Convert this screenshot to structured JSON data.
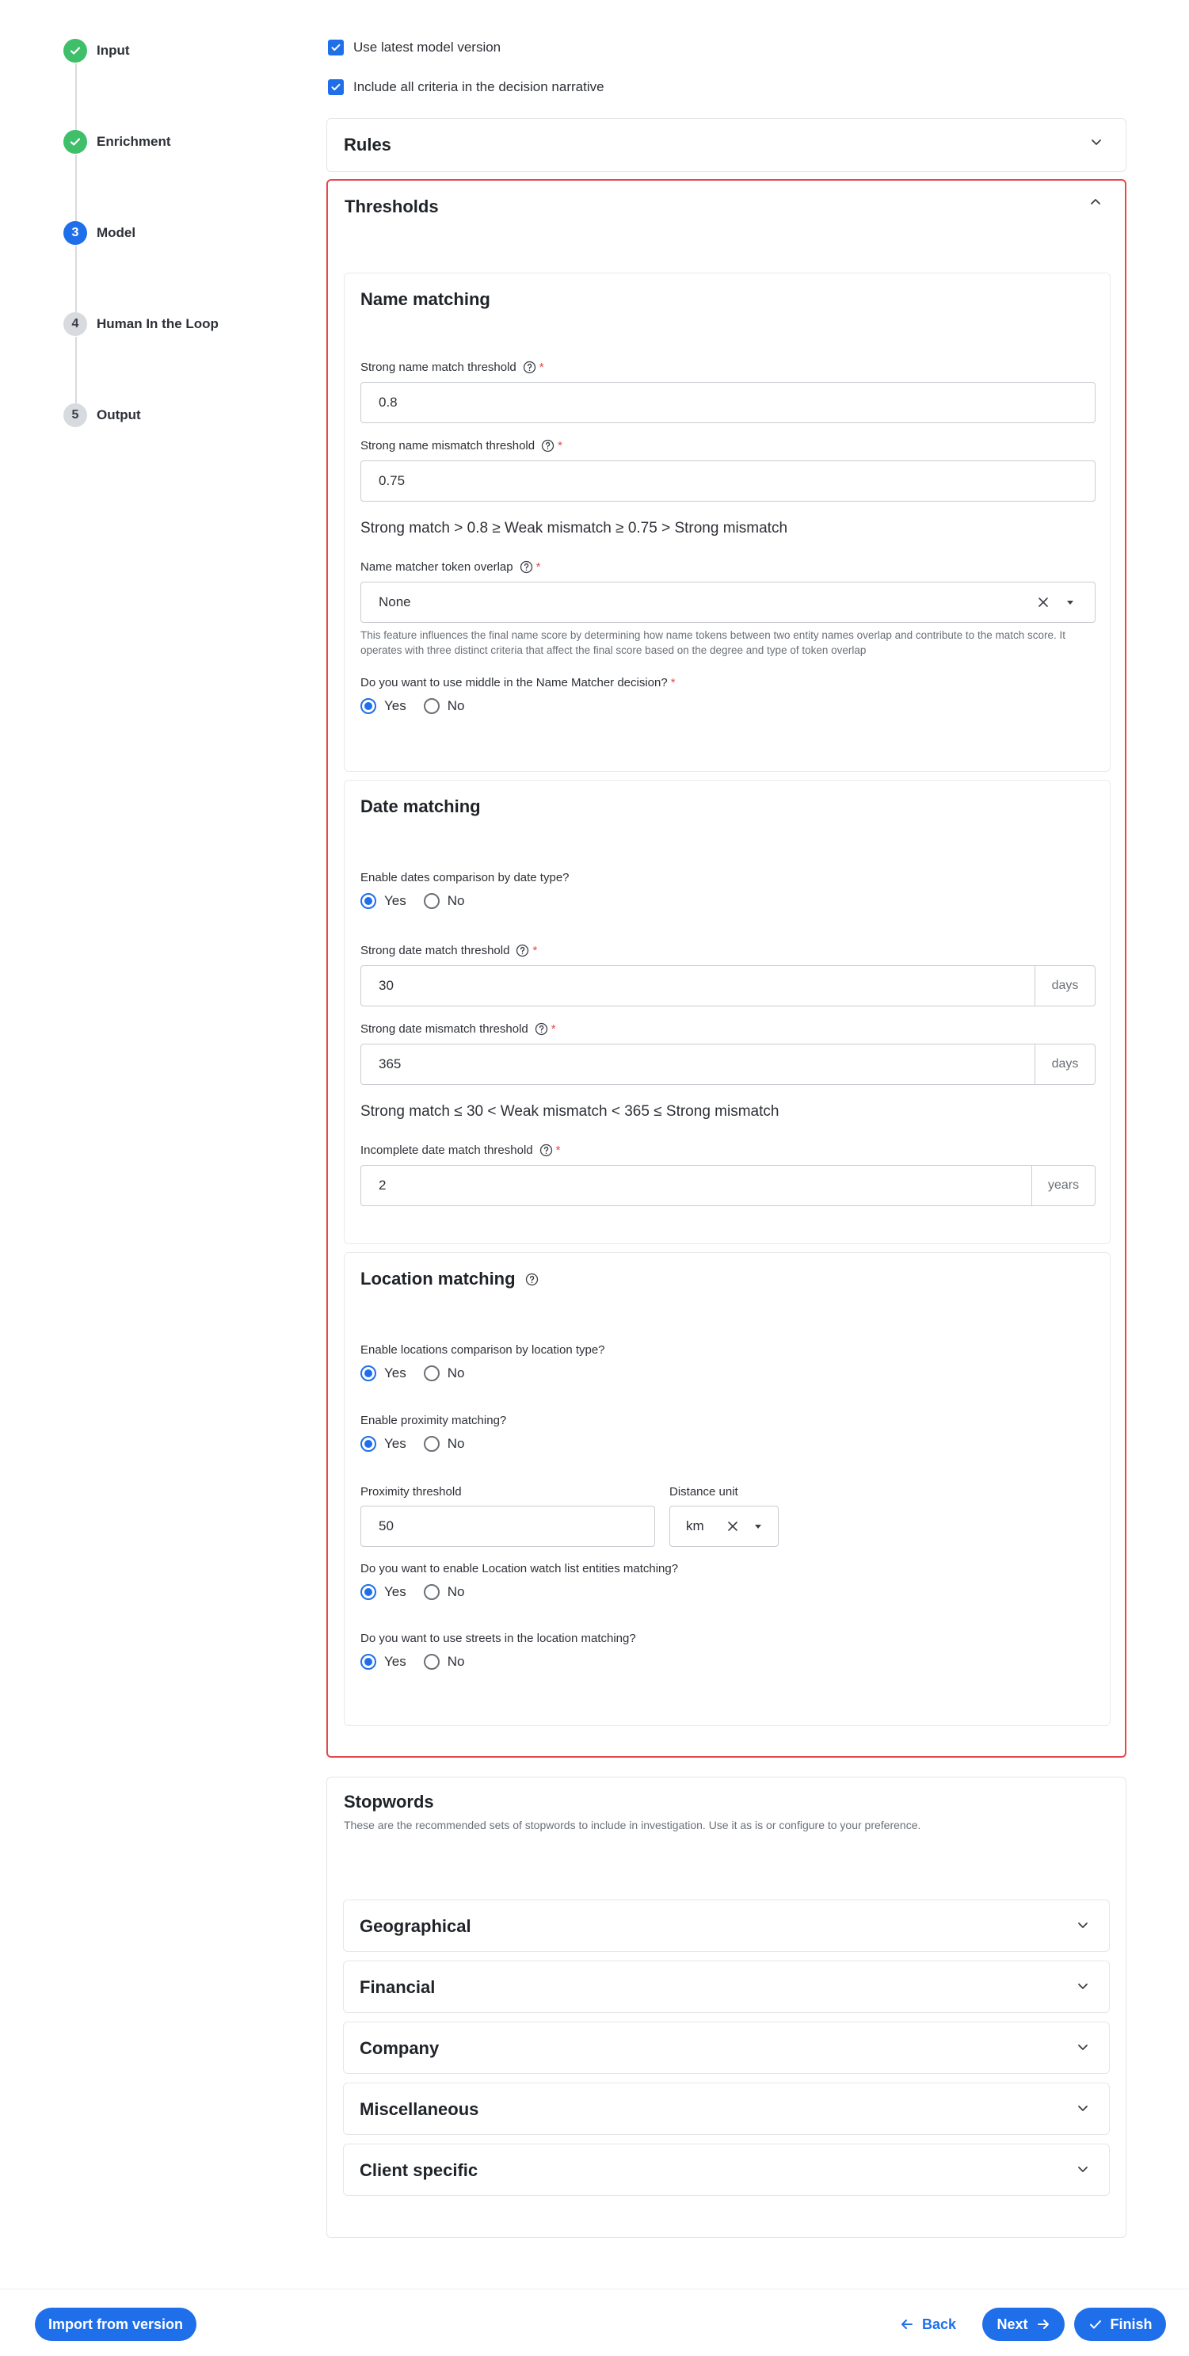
{
  "stepper": {
    "steps": [
      {
        "label": "Input",
        "state": "done",
        "number": ""
      },
      {
        "label": "Enrichment",
        "state": "done",
        "number": ""
      },
      {
        "label": "Model",
        "state": "active",
        "number": "3"
      },
      {
        "label": "Human In the Loop",
        "state": "todo",
        "number": "4"
      },
      {
        "label": "Output",
        "state": "todo",
        "number": "5"
      }
    ]
  },
  "options": {
    "use_latest_model": "Use latest model version",
    "include_all_criteria": "Include all criteria in the decision narrative"
  },
  "rules": {
    "title": "Rules"
  },
  "thresholds": {
    "title": "Thresholds",
    "name_matching": {
      "title": "Name matching",
      "strong_match_label": "Strong name match threshold",
      "strong_match_value": "0.8",
      "strong_mismatch_label": "Strong name mismatch threshold",
      "strong_mismatch_value": "0.75",
      "formula": "Strong match > 0.8 ≥ Weak mismatch ≥ 0.75 > Strong mismatch",
      "token_overlap_label": "Name matcher token overlap",
      "token_overlap_value": "None",
      "token_overlap_helper": "This feature influences the final name score by determining how name tokens between two entity names overlap and contribute to the match score. It operates with three distinct criteria that affect the final score based on the degree and type of token overlap",
      "middle_question": "Do you want to use middle in the Name Matcher decision?"
    },
    "date_matching": {
      "title": "Date matching",
      "enable_question": "Enable dates comparison by date type?",
      "strong_match_label": "Strong date match threshold",
      "strong_match_value": "30",
      "strong_match_unit": "days",
      "strong_mismatch_label": "Strong date mismatch threshold",
      "strong_mismatch_value": "365",
      "strong_mismatch_unit": "days",
      "formula": "Strong match ≤ 30 < Weak mismatch < 365 ≤  Strong mismatch",
      "incomplete_label": "Incomplete date match threshold",
      "incomplete_value": "2",
      "incomplete_unit": "years"
    },
    "location_matching": {
      "title": "Location matching",
      "enable_question": "Enable locations comparison by location type?",
      "proximity_question": "Enable proximity matching?",
      "proximity_label": "Proximity threshold",
      "proximity_value": "50",
      "distance_unit_label": "Distance unit",
      "distance_unit_value": "km",
      "watchlist_question": "Do you want to enable Location watch list entities matching?",
      "streets_question": "Do you want to use streets in the location matching?"
    },
    "yes": "Yes",
    "no": "No"
  },
  "stopwords": {
    "title": "Stopwords",
    "description": "These are the recommended sets of stopwords to include in investigation. Use it as is or configure to your preference.",
    "groups": [
      "Geographical",
      "Financial",
      "Company",
      "Miscellaneous",
      "Client specific"
    ]
  },
  "footer": {
    "import_label": "Import from version",
    "back_label": "Back",
    "next_label": "Next",
    "finish_label": "Finish"
  },
  "colors": {
    "primary": "#1f6feb",
    "done": "#3fbf6a",
    "highlight_border": "#e5484d"
  }
}
